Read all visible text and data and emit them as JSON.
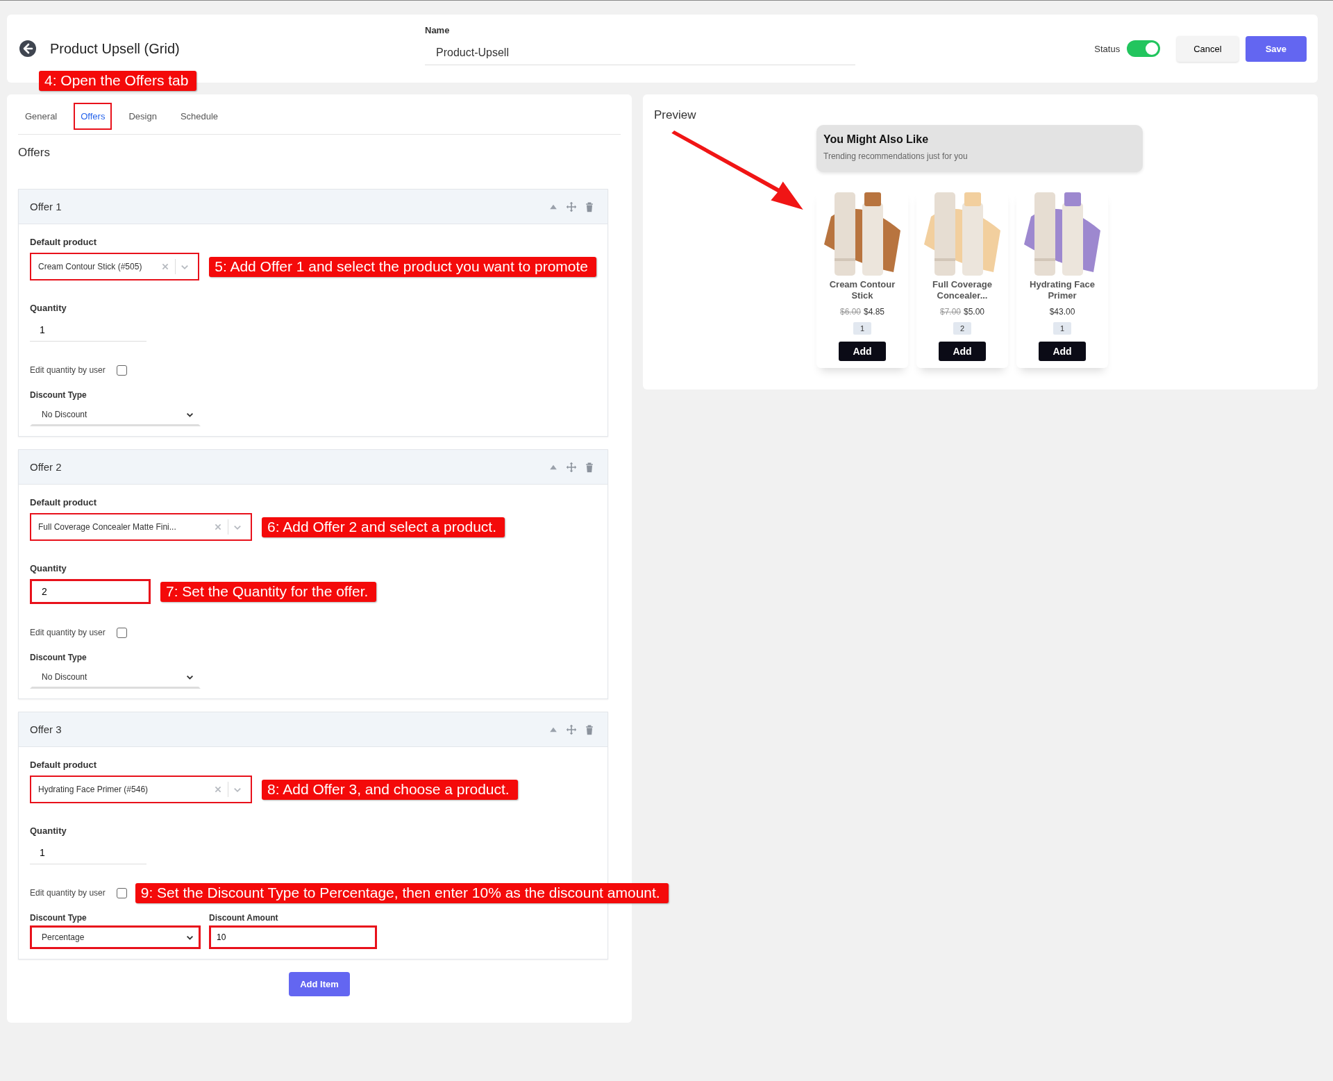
{
  "header": {
    "title": "Product Upsell (Grid)",
    "name_label": "Name",
    "name_value": "Product-Upsell",
    "status_label": "Status",
    "status_on": true,
    "cancel": "Cancel",
    "save": "Save"
  },
  "tabs": [
    {
      "label": "General",
      "selected": false,
      "highlighted": false
    },
    {
      "label": "Offers",
      "selected": true,
      "highlighted": true
    },
    {
      "label": "Design",
      "selected": false,
      "highlighted": false
    },
    {
      "label": "Schedule",
      "selected": false,
      "highlighted": false
    }
  ],
  "tabs_note": "4: Open the Offers tab",
  "section_title": "Offers",
  "offers": [
    {
      "title": "Offer 1",
      "product_label": "Default product",
      "product": "Cream Contour Stick (#505)",
      "product_highlighted": true,
      "product_note": "5: Add Offer 1 and select the product you want to promote",
      "quantity_label": "Quantity",
      "quantity": "1",
      "quantity_highlighted": false,
      "edit_label": "Edit quantity by user",
      "edit_checked": false,
      "discount_label": "Discount Type",
      "discount": "No Discount",
      "discount_highlighted": false
    },
    {
      "title": "Offer 2",
      "product_label": "Default product",
      "product": "Full Coverage Concealer Matte Fini...",
      "product_highlighted": true,
      "product_note": "6: Add Offer 2 and select a product.",
      "quantity_label": "Quantity",
      "quantity": "2",
      "quantity_highlighted": true,
      "quantity_note": "7: Set the Quantity for the offer.",
      "edit_label": "Edit quantity by user",
      "edit_checked": false,
      "discount_label": "Discount Type",
      "discount": "No Discount",
      "discount_highlighted": false
    },
    {
      "title": "Offer 3",
      "product_label": "Default product",
      "product": "Hydrating Face Primer (#546)",
      "product_highlighted": true,
      "product_note": "8: Add Offer 3, and choose a product.",
      "quantity_label": "Quantity",
      "quantity": "1",
      "quantity_highlighted": false,
      "edit_label": "Edit quantity by user",
      "edit_checked": false,
      "edit_note": "9: Set the Discount Type to Percentage, then enter 10% as the discount amount.",
      "discount_label": "Discount Type",
      "discount": "Percentage",
      "discount_highlighted": true,
      "amount_label": "Discount Amount",
      "amount": "10",
      "amount_highlighted": true
    }
  ],
  "add_item": "Add Item",
  "preview": {
    "title": "Preview",
    "banner_title": "You Might Also Like",
    "banner_subtitle": "Trending recommendations just for you",
    "products": [
      {
        "kind": "picture",
        "color": "#b8743f",
        "name": "Cream Contour Stick",
        "old_price": "$6.00",
        "price": "$4.85",
        "qty": "1",
        "button": "Add"
      },
      {
        "kind": "picture",
        "color": "#f2cf9e",
        "name": "Full Coverage Concealer...",
        "old_price": "$7.00",
        "price": "$5.00",
        "qty": "2",
        "button": "Add"
      },
      {
        "kind": "picture",
        "color": "#9d88cf",
        "name": "Hydrating Face Primer",
        "price": "$43.00",
        "qty": "1",
        "button": "Add"
      }
    ]
  }
}
